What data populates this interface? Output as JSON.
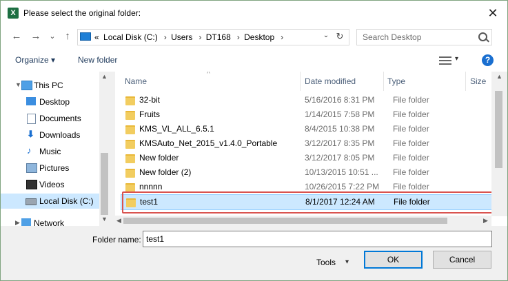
{
  "window": {
    "title": "Please select the original folder:",
    "app_icon": "X",
    "close": "✕"
  },
  "nav": {
    "back": "←",
    "forward": "→",
    "dropdown": "⌄",
    "up": "↑",
    "address": {
      "prefix": "«",
      "crumbs": [
        "Local Disk (C:)",
        "Users",
        "DT168",
        "Desktop"
      ],
      "sep": "›",
      "dropdown": "⌄",
      "refresh": "↻"
    },
    "search_placeholder": "Search Desktop"
  },
  "commands": {
    "organize": "Organize ▾",
    "new_folder": "New folder",
    "help": "?",
    "view_dropdown": "▾"
  },
  "sidebar": {
    "items": [
      {
        "label": "This PC"
      },
      {
        "label": "Desktop"
      },
      {
        "label": "Documents"
      },
      {
        "label": "Downloads"
      },
      {
        "label": "Music"
      },
      {
        "label": "Pictures"
      },
      {
        "label": "Videos"
      },
      {
        "label": "Local Disk (C:)"
      },
      {
        "label": "Network"
      }
    ]
  },
  "list": {
    "columns": [
      "Name",
      "Date modified",
      "Type",
      "Size"
    ],
    "rows": [
      {
        "name": "32-bit",
        "date": "5/16/2016 8:31 PM",
        "type": "File folder"
      },
      {
        "name": "Fruits",
        "date": "1/14/2015 7:58 PM",
        "type": "File folder"
      },
      {
        "name": "KMS_VL_ALL_6.5.1",
        "date": "8/4/2015 10:38 PM",
        "type": "File folder"
      },
      {
        "name": "KMSAuto_Net_2015_v1.4.0_Portable",
        "date": "3/12/2017 8:35 PM",
        "type": "File folder"
      },
      {
        "name": "New folder",
        "date": "3/12/2017 8:05 PM",
        "type": "File folder"
      },
      {
        "name": "New folder (2)",
        "date": "10/13/2015 10:51 ...",
        "type": "File folder"
      },
      {
        "name": "nnnnn",
        "date": "10/26/2015 7:22 PM",
        "type": "File folder"
      },
      {
        "name": "test1",
        "date": "8/1/2017 12:24 AM",
        "type": "File folder"
      }
    ]
  },
  "bottom": {
    "folder_name_label": "Folder name:",
    "folder_name_value": "test1",
    "tools": "Tools",
    "tools_dd": "▾",
    "ok": "OK",
    "cancel": "Cancel"
  }
}
